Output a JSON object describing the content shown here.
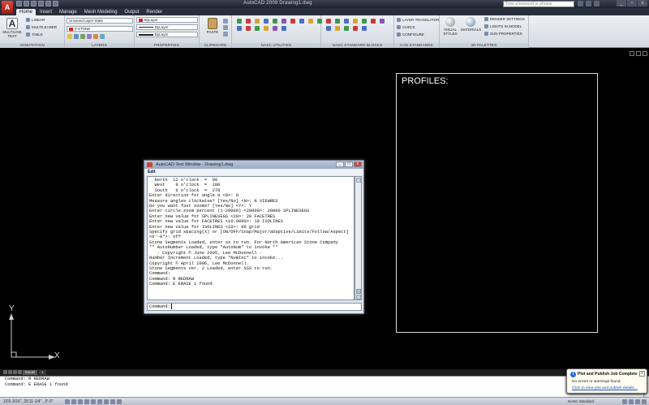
{
  "app": {
    "button_label": "A",
    "window_title": "AutoCAD 2009   Drawing1.dwg"
  },
  "search": {
    "placeholder": "Type a keyword or phrase"
  },
  "window_buttons": [
    "_",
    "▫",
    "x"
  ],
  "tabs": [
    "Home",
    "Insert",
    "Manage",
    "Mesh Modeling",
    "Output",
    "Render"
  ],
  "ribbon": {
    "annotation": {
      "label": "ANNOTATION",
      "multiline_text": "MULTILINE TEXT",
      "linear": "LINEAR",
      "multileader": "MULTILEADER",
      "table": "TABLE"
    },
    "layers": {
      "label": "LAYERS",
      "layer_state": "Unsaved Layer State",
      "current_layer": "0-STONE"
    },
    "properties": {
      "label": "PROPERTIES",
      "color": "ByLayer",
      "linetype": "ByLayer",
      "lineweight": "ByLayer"
    },
    "clipboard": {
      "label": "CLIPBOARD",
      "paste": "PASTE"
    },
    "nasc_utilities": {
      "label": "NASC UTILITIES"
    },
    "nasc_standard_blocks": {
      "label": "NASC STANDARD BLOCKS"
    },
    "cad_standards": {
      "label": "CAD STANDARDS",
      "layer_translator": "LAYER TRANSLATOR",
      "check": "CHECK",
      "configure": "CONFIGURE"
    },
    "palettes_3d": {
      "label": "3D PALETTES",
      "visual_styles": "VISUAL STYLES",
      "materials": "MATERIALS",
      "render_settings": "RENDER SETTINGS",
      "lights_in_model": "LIGHTS IN MODEL",
      "sun_properties": "SUN PROPERTIES"
    }
  },
  "drawing": {
    "profiles_title": "PROFILES:",
    "ucs_x": "X",
    "ucs_y": "Y"
  },
  "text_window": {
    "title": "AutoCAD Text Window - Drawing1.dwg",
    "menu": "Edit",
    "buttons": [
      "_",
      "□",
      "x"
    ],
    "history": [
      "  North  12 o'clock  =  90",
      "  West    9 o'clock  =  180",
      "  South   6 o'clock  =  270",
      "Enter direction for angle 0 <0>: 0",
      "Measure angles clockwise? [Yes/No] <N>: N VIEWRES",
      "Do you want fast zooms? [Yes/No] <Y>: Y",
      "Enter circle zoom percent (1-20000) <20000>: 20000 SPLINESEGS",
      "Enter new value for SPLINESEGS <20>: 20 FACETRES",
      "Enter new value for FACETRES <10.0000>: 10 ISOLINES",
      "Enter new value for ISOLINES <10>: 90 grid",
      "Specify grid spacing(X) or [ON/OFF/Snap/Major/aDaptive/Limits/Follow/Aspect]",
      "<0'-0\">: off",
      "Stone Segments Loaded, enter ss to run. For North American Stone Company",
      "** AutoNumber Loaded, type \"AutoNum\" to invoke **",
      "   - Copyright © June 2005, Lee McDonnell -",
      "Number Increment Loaded, type \"NumInc\" to invoke...",
      "",
      "Copyright © April 2006, Lee McDonnell.",
      "Stone Segments ver. 2 Loaded, enter SSS to run.",
      "Command:",
      "Command: R REDRAW",
      "Command: E ERASE 1 found"
    ],
    "prompt": "Command:"
  },
  "layout_tabs": [
    "Model",
    "1"
  ],
  "command_line": [
    "Command: R REDRAW",
    "Command: E ERASE 1 found"
  ],
  "status": {
    "coordinates": "10'6-3/16\", 25'11-1/4\" , 0'-0\"",
    "annotation_scale": "NASC Standard"
  },
  "notification": {
    "title": "Plot and Publish Job Complete",
    "message": "No errors or warnings found",
    "link": "Click to view plot and publish details...",
    "close": "x",
    "icon_letter": "i"
  }
}
